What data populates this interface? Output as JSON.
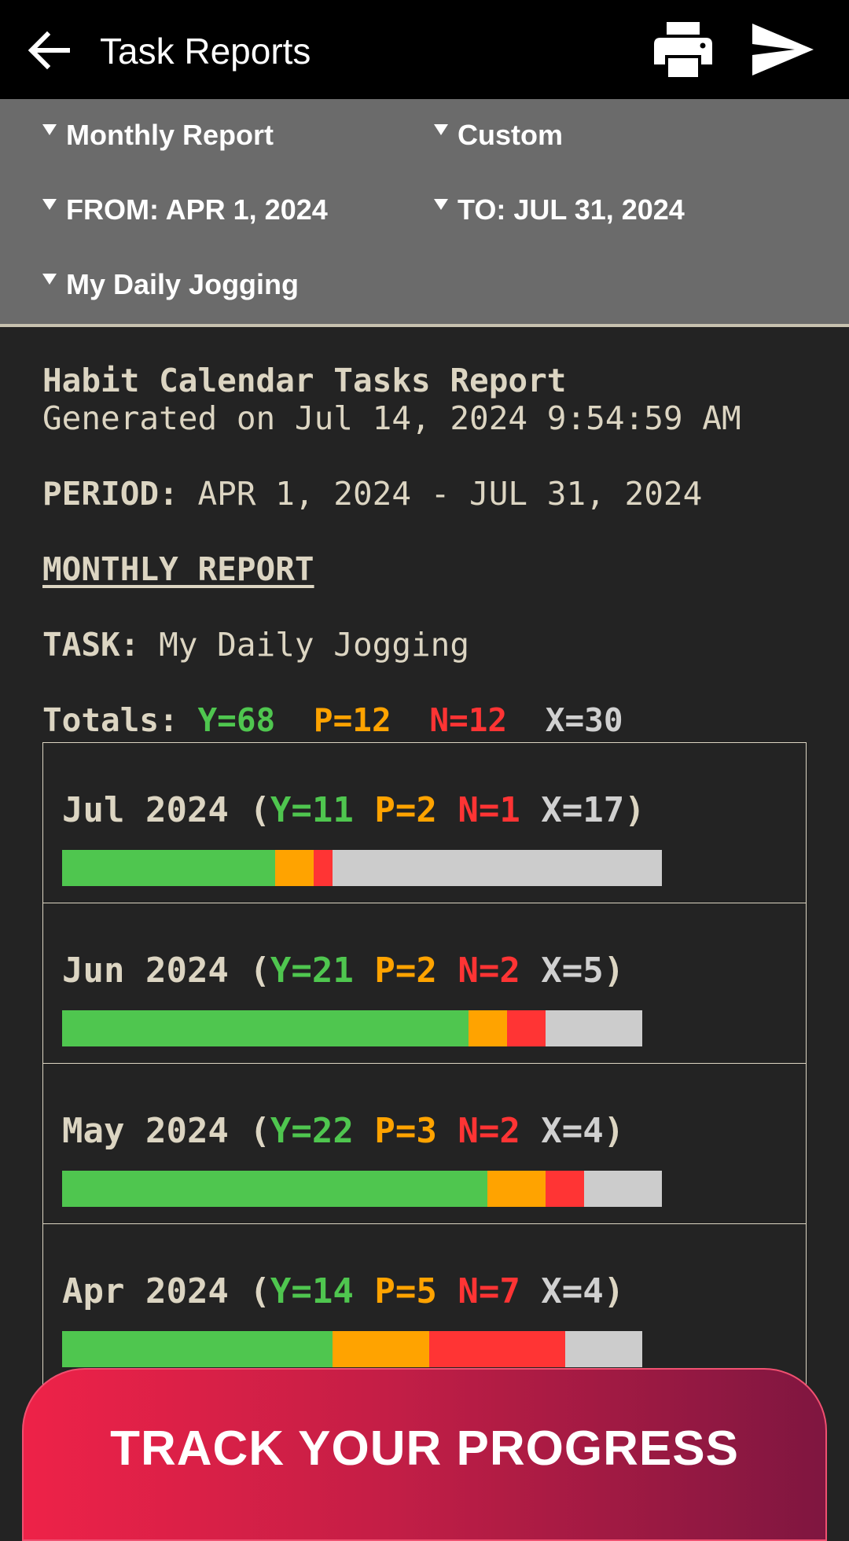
{
  "app_bar": {
    "title": "Task Reports",
    "back_icon": "arrow-left-icon",
    "print_icon": "printer-icon",
    "send_icon": "send-icon"
  },
  "filters": {
    "report_type": "Monthly Report",
    "range_type": "Custom",
    "from": "FROM: APR 1, 2024",
    "to": "TO: JUL 31, 2024",
    "task": "My Daily Jogging"
  },
  "report": {
    "title": "Habit Calendar Tasks Report",
    "generated": "Generated on Jul 14, 2024 9:54:59 AM",
    "period_label": "PERIOD:",
    "period_value": "APR 1, 2024 - JUL 31, 2024",
    "section": "MONTHLY REPORT",
    "task_label": "TASK:",
    "task_value": "My Daily Jogging",
    "totals_label": "Totals:",
    "totals": {
      "y": "Y=68",
      "p": "P=12",
      "n": "N=12",
      "x": "X=30"
    }
  },
  "colors": {
    "yes": "#4fc64f",
    "partial": "#ffa300",
    "no": "#ff3434",
    "none": "#cccccc"
  },
  "months": [
    {
      "name": "Jul 2024",
      "y": 11,
      "p": 2,
      "n": 1,
      "x": 17
    },
    {
      "name": "Jun 2024",
      "y": 21,
      "p": 2,
      "n": 2,
      "x": 5
    },
    {
      "name": "May 2024",
      "y": 22,
      "p": 3,
      "n": 2,
      "x": 4
    },
    {
      "name": "Apr 2024",
      "y": 14,
      "p": 5,
      "n": 7,
      "x": 4
    }
  ],
  "banner": {
    "text": "TRACK YOUR PROGRESS"
  }
}
